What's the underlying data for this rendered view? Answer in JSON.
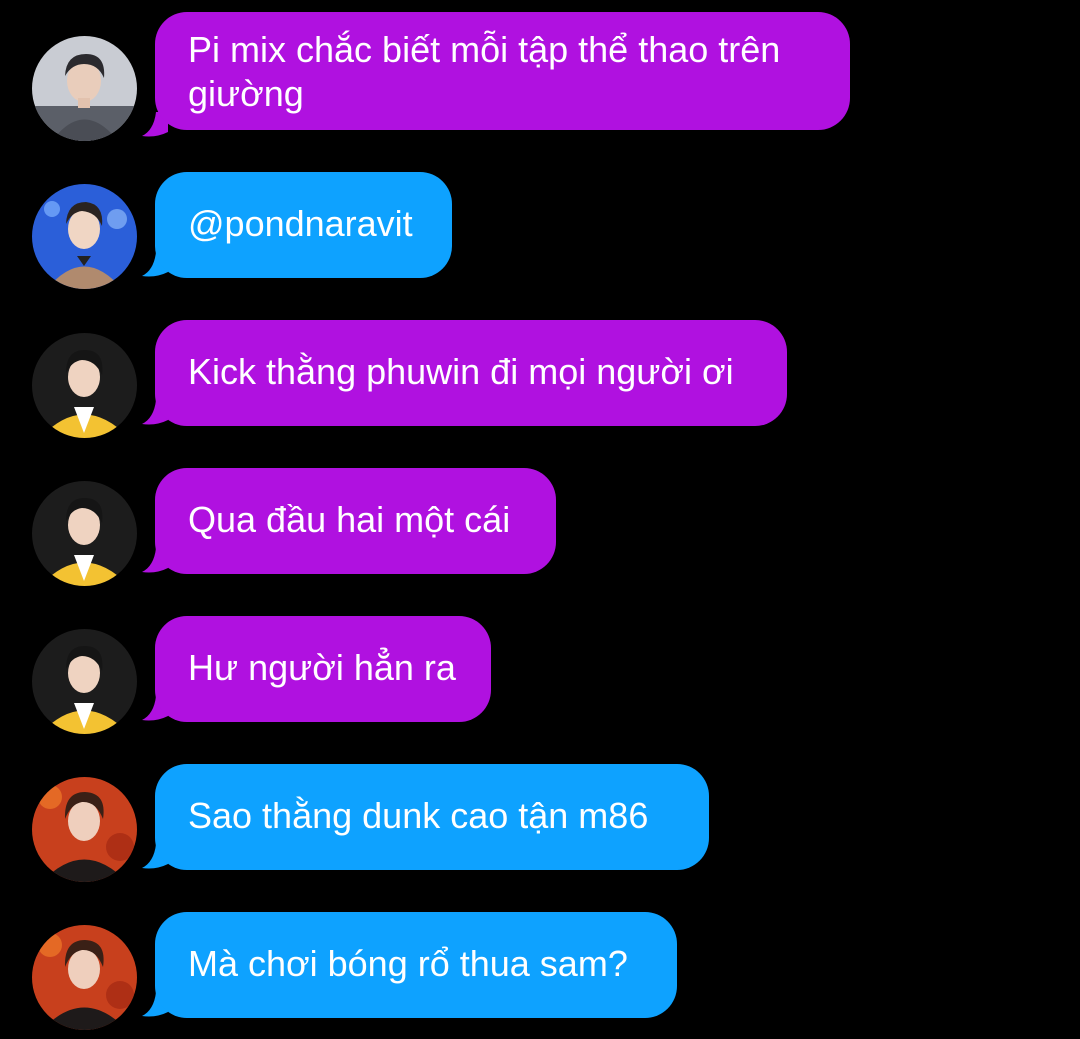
{
  "conversation": {
    "messages": [
      {
        "text": "Pi mix chắc biết mỗi tập thể thao trên giường",
        "bubble_color": "#b011e0",
        "avatar": "avatar-gray-jacket"
      },
      {
        "text": "@pondnaravit",
        "bubble_color": "#0ea2ff",
        "avatar": "avatar-blue-stage"
      },
      {
        "text": "Kick thằng phuwin đi mọi người ơi",
        "bubble_color": "#b011e0",
        "avatar": "avatar-yellow-jacket"
      },
      {
        "text": "Qua đầu hai một cái",
        "bubble_color": "#b011e0",
        "avatar": "avatar-yellow-jacket"
      },
      {
        "text": "Hư người hẳn ra",
        "bubble_color": "#b011e0",
        "avatar": "avatar-yellow-jacket"
      },
      {
        "text": "Sao thằng dunk cao tận m86",
        "bubble_color": "#0ea2ff",
        "avatar": "avatar-orange-stage"
      },
      {
        "text": "Mà chơi bóng rổ thua sam?",
        "bubble_color": "#0ea2ff",
        "avatar": "avatar-orange-stage"
      }
    ]
  },
  "colors": {
    "background": "#000000",
    "purple_bubble": "#b011e0",
    "blue_bubble": "#0ea2ff",
    "text": "#ffffff"
  }
}
